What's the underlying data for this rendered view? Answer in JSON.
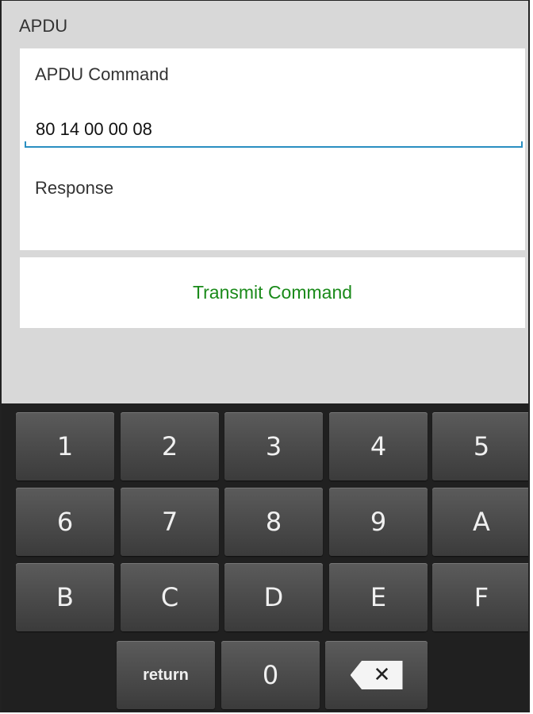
{
  "section": {
    "title": "APDU"
  },
  "command": {
    "label": "APDU Command",
    "value": "80 14 00 00 08"
  },
  "response": {
    "label": "Response"
  },
  "transmit": {
    "label": "Transmit Command"
  },
  "keyboard": {
    "row1": [
      "1",
      "2",
      "3",
      "4",
      "5"
    ],
    "row2": [
      "6",
      "7",
      "8",
      "9",
      "A"
    ],
    "row3": [
      "B",
      "C",
      "D",
      "E",
      "F"
    ],
    "return_label": "return",
    "zero": "0",
    "backspace_icon": "backspace-icon"
  },
  "colors": {
    "accent_underline": "#2a8fc1",
    "transmit_text": "#1a8a1a",
    "keyboard_bg": "#202020"
  }
}
